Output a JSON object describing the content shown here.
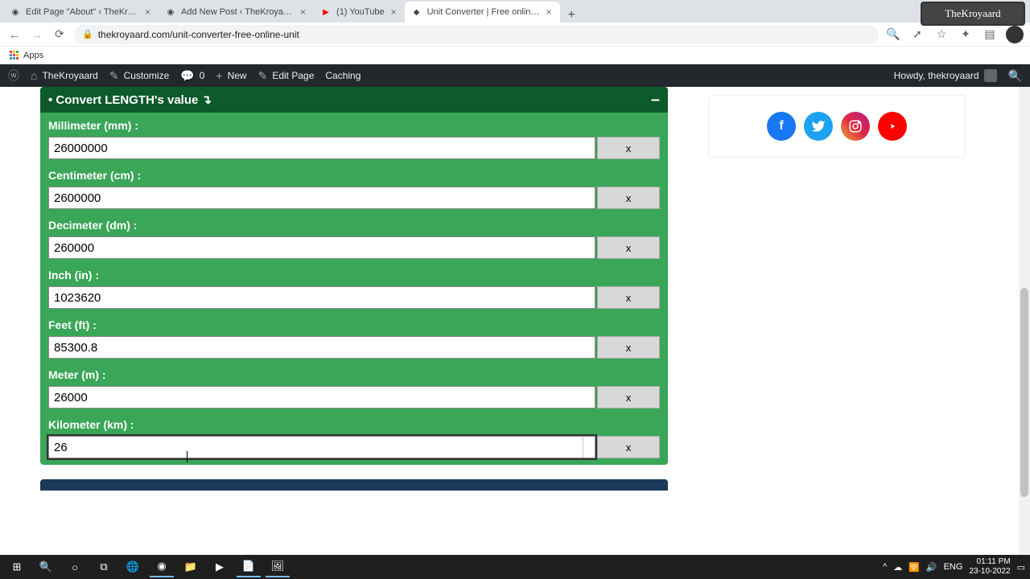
{
  "browser": {
    "tabs": [
      {
        "title": "Edit Page \"About\" ‹ TheKroyaard"
      },
      {
        "title": "Add New Post ‹ TheKroyaard —"
      },
      {
        "title": "(1) YouTube"
      },
      {
        "title": "Unit Converter | Free online Unit"
      }
    ],
    "new_tab": "+",
    "url": "thekroyaard.com/unit-converter-free-online-unit",
    "brand": "TheKroyaard",
    "bookmarks_apps": "Apps"
  },
  "wp": {
    "site": "TheKroyaard",
    "customize": "Customize",
    "comments": "0",
    "new": "New",
    "edit_page": "Edit Page",
    "caching": "Caching",
    "howdy": "Howdy, thekroyaard"
  },
  "converter": {
    "header": "• Convert LENGTH's value ↴",
    "collapse": "–",
    "clear_label": "x",
    "fields": [
      {
        "label": "Millimeter (mm) :",
        "value": "26000000"
      },
      {
        "label": "Centimeter (cm) :",
        "value": "2600000"
      },
      {
        "label": "Decimeter (dm) :",
        "value": "260000"
      },
      {
        "label": "Inch (in) :",
        "value": "1023620"
      },
      {
        "label": "Feet (ft) :",
        "value": "85300.8"
      },
      {
        "label": "Meter (m) :",
        "value": "26000"
      },
      {
        "label": "Kilometer (km) :",
        "value": "26"
      }
    ]
  },
  "taskbar": {
    "time": "01:11 PM",
    "date": "23-10-2022",
    "lang": "ENG"
  }
}
